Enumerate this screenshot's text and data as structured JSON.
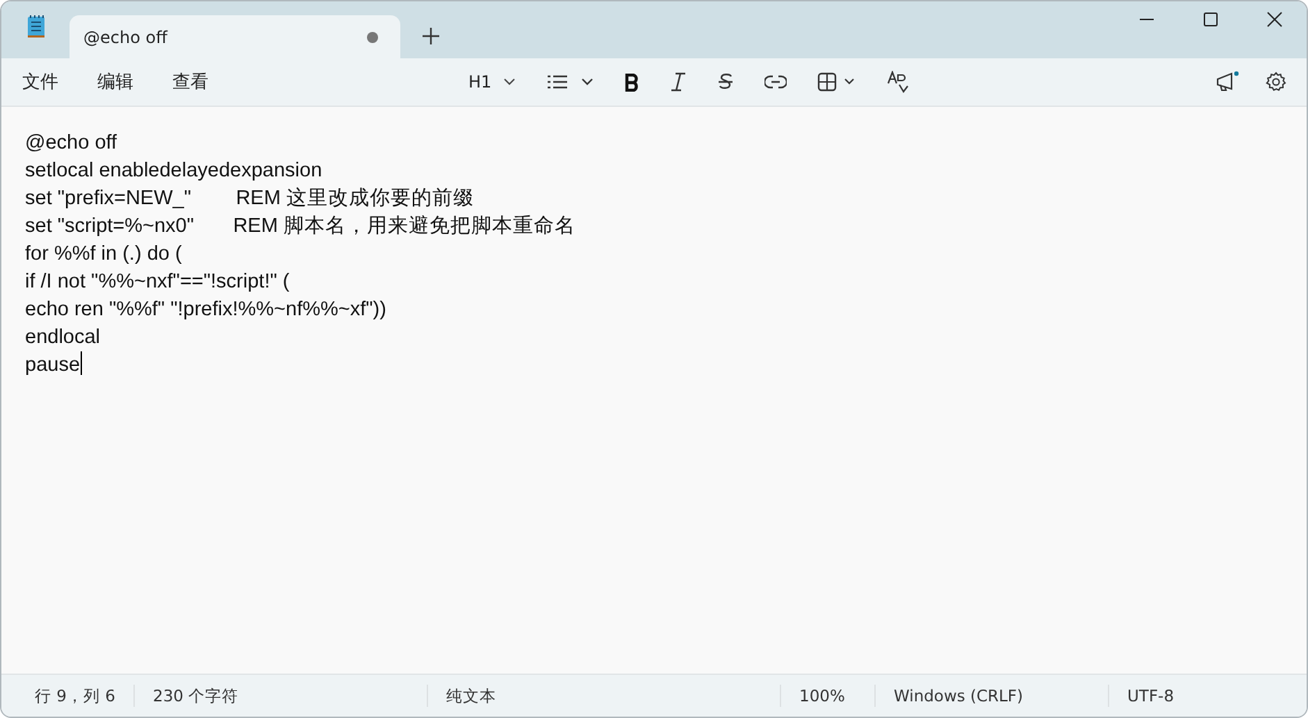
{
  "tab": {
    "title": "@echo off",
    "modified": true
  },
  "menu": [
    "文件",
    "编辑",
    "查看"
  ],
  "format_toolbar": [
    {
      "kind": "heading",
      "label": "H1"
    },
    {
      "kind": "list"
    },
    {
      "kind": "bold"
    },
    {
      "kind": "italic"
    },
    {
      "kind": "strike"
    },
    {
      "kind": "link"
    },
    {
      "kind": "table"
    },
    {
      "kind": "clear"
    }
  ],
  "editor": {
    "lines": [
      "@echo off",
      "setlocal enabledelayedexpansion",
      "set \"prefix=NEW_\"        REM 这里改成你要的前缀",
      "set \"script=%~nx0\"       REM 脚本名，用来避免把脚本重命名",
      "for %%f in (.) do (",
      "if /I not \"%%~nxf\"==\"!script!\" (",
      "echo ren \"%%f\" \"!prefix!%%~nf%%~xf\"))",
      "endlocal",
      "pause"
    ]
  },
  "status_bar": {
    "position": "行 9，列 6",
    "characters": "230 个字符",
    "format": "纯文本",
    "zoom": "100%",
    "line_ending": "Windows (CRLF)",
    "encoding": "UTF-8"
  }
}
